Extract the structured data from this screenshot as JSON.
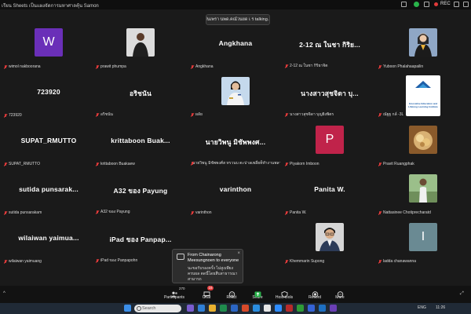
{
  "window": {
    "title": "เรียน Sheets เป็นแผงจัดการมหาศาลคุ้น Samon",
    "rec_label": "REC"
  },
  "talking_banner": "วันเพรา นพด.คณ์วนยด เ ร talking...",
  "tiles": [
    {
      "id": "wimol",
      "display": "letter",
      "letter": "W",
      "avatar_color": "#6a2fb8",
      "label": "wimol nakboorana"
    },
    {
      "id": "prawit",
      "display": "photo",
      "photo": "man-dark-suit",
      "label": "prawit phumpa"
    },
    {
      "id": "angkhana",
      "display": "name",
      "name": "Angkhana",
      "label": "Angkhana"
    },
    {
      "id": "pinsa",
      "display": "name",
      "name": "2-12 ณ ในชา กิริย...",
      "label": "2-12 ณ ในชา กิริยาจิต"
    },
    {
      "id": "yuboon",
      "display": "photo",
      "photo": "woman-graduate",
      "label": "Yuboon Phalahaapailin"
    },
    {
      "id": "n723920",
      "display": "name",
      "name": "723920",
      "label": "723920"
    },
    {
      "id": "ochanan",
      "display": "name",
      "name": "อริชนัน",
      "label": "อริชนัน"
    },
    {
      "id": "hathai",
      "display": "photo",
      "photo": "woman-uniform",
      "label": "ผลัย"
    },
    {
      "id": "nangsao",
      "display": "name",
      "name": "นางสาวสุชจิดา บุ...",
      "label": "นางสาวสุชจิดา บุญยิงพิตร"
    },
    {
      "id": "nasduang",
      "display": "photo",
      "photo": "logo-institute",
      "label": "ณัฐฐ กล์ -3L",
      "logo_text": "Innovative Education and Lifelong Learning Institute"
    },
    {
      "id": "supat",
      "display": "name",
      "name": "SUPAT_RMUTTO",
      "label": "SUPAT_RMUTTO"
    },
    {
      "id": "krittaboon",
      "display": "name",
      "name": "krittaboon  Buak...",
      "label": "krittaboon Buakaew"
    },
    {
      "id": "nawiphan",
      "display": "name",
      "name": "นายวิพนู มิชัพพงศ...",
      "label": "นายวิพนู มิชัพพงศ์ส ทรวนบ ตะปาลเพลี่ยท็ทำงานพลาทยา"
    },
    {
      "id": "piyakorn",
      "display": "letter",
      "letter": "P",
      "avatar_color": "#c0234a",
      "label": "Piyakorn Imboon"
    },
    {
      "id": "pravit",
      "display": "photo",
      "photo": "food-plate",
      "label": "Pravit Ruangphak"
    },
    {
      "id": "sutida",
      "display": "name",
      "name": "sutida  punsarak...",
      "label": "sutida punsarakam"
    },
    {
      "id": "a32",
      "display": "name",
      "name": "A32 ของ Payung",
      "label": "A32 ของ Payung"
    },
    {
      "id": "varinthon",
      "display": "name",
      "name": "varinthon",
      "label": "varinthon"
    },
    {
      "id": "panita",
      "display": "name",
      "name": "Panita W.",
      "label": "Panita W."
    },
    {
      "id": "nattasinee",
      "display": "photo",
      "photo": "person-outdoor",
      "label": "Nattasinee Chotiprecharatd"
    },
    {
      "id": "wilaiwan",
      "display": "name",
      "name": "wilaiwan  yaimua...",
      "label": "wilaiwan yaimuang"
    },
    {
      "id": "ipad",
      "display": "name",
      "name": "iPad ของ Panpap...",
      "label": "iPad ของ Panpapohn"
    },
    {
      "id": "empty",
      "display": "none",
      "label": ""
    },
    {
      "id": "khemmarin",
      "display": "photo",
      "photo": "man-glasses",
      "label": "Khemmarin Supong"
    },
    {
      "id": "ladda",
      "display": "letter",
      "letter": "I",
      "avatar_color": "#6a8a93",
      "label": "ladda chanawanna"
    }
  ],
  "chat_popup": {
    "from": "From Chainarong Meesungnoen to everyone",
    "message": "นะขอรับรองครั้ง ไม่สูงเพียง ครบผล ตดนี้โดยสืบสาธารณาสามารถ",
    "close": "×"
  },
  "toolbar": {
    "participants": {
      "label": "Participants",
      "count": "270"
    },
    "chat": {
      "label": "Chat",
      "badge": "16"
    },
    "react": {
      "label": "React"
    },
    "share": {
      "label": "Share"
    },
    "host_tools": {
      "label": "Host tools"
    },
    "record": {
      "label": "Record"
    },
    "more": {
      "label": "More"
    }
  },
  "taskbar": {
    "search_placeholder": "Search",
    "tray_lang": "ENG",
    "tray_time": "11:26"
  },
  "colors": {
    "background": "#1a1a1a",
    "accent_red": "#e03a3a",
    "shield_green": "#29b34a"
  }
}
